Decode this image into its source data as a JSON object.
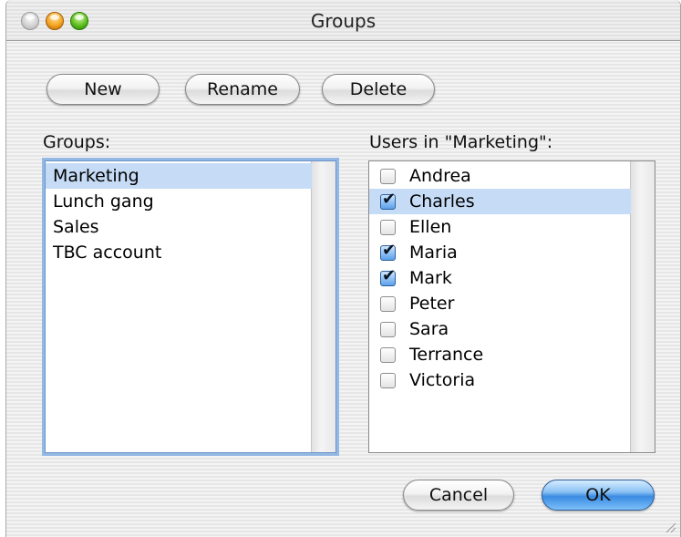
{
  "window": {
    "title": "Groups"
  },
  "toolbar": {
    "new_label": "New",
    "rename_label": "Rename",
    "delete_label": "Delete"
  },
  "groups": {
    "label": "Groups:",
    "items": [
      "Marketing",
      "Lunch gang",
      "Sales",
      "TBC account"
    ],
    "selected": "Marketing"
  },
  "users": {
    "label": "Users in \"Marketing\":",
    "items": [
      {
        "name": "Andrea",
        "checked": false
      },
      {
        "name": "Charles",
        "checked": true,
        "selected": true
      },
      {
        "name": "Ellen",
        "checked": false
      },
      {
        "name": "Maria",
        "checked": true
      },
      {
        "name": "Mark",
        "checked": true
      },
      {
        "name": "Peter",
        "checked": false
      },
      {
        "name": "Sara",
        "checked": false
      },
      {
        "name": "Terrance",
        "checked": false
      },
      {
        "name": "Victoria",
        "checked": false
      }
    ]
  },
  "footer": {
    "cancel_label": "Cancel",
    "ok_label": "OK"
  },
  "colors": {
    "selection": "#c6dcf6",
    "focus_ring": "#93b8e3",
    "default_button": "#3a8be2"
  },
  "icons": {
    "close": "close-icon",
    "minimize": "minimize-icon",
    "zoom": "zoom-icon",
    "resize": "resize-grip-icon"
  }
}
